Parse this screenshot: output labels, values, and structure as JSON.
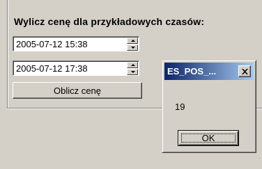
{
  "form": {
    "title": "Wylicz cenę dla przykładowych czasów:",
    "start_time": "2005-07-12 15:38",
    "end_time": "2005-07-12 17:38",
    "calculate_label": "Oblicz cenę"
  },
  "dialog": {
    "title": "ES_POS_...",
    "message": "19",
    "ok_label": "OK",
    "close_glyph": "✕"
  },
  "icons": {
    "spin_up": "triangle-up-icon",
    "spin_down": "triangle-down-icon",
    "close": "close-icon"
  }
}
